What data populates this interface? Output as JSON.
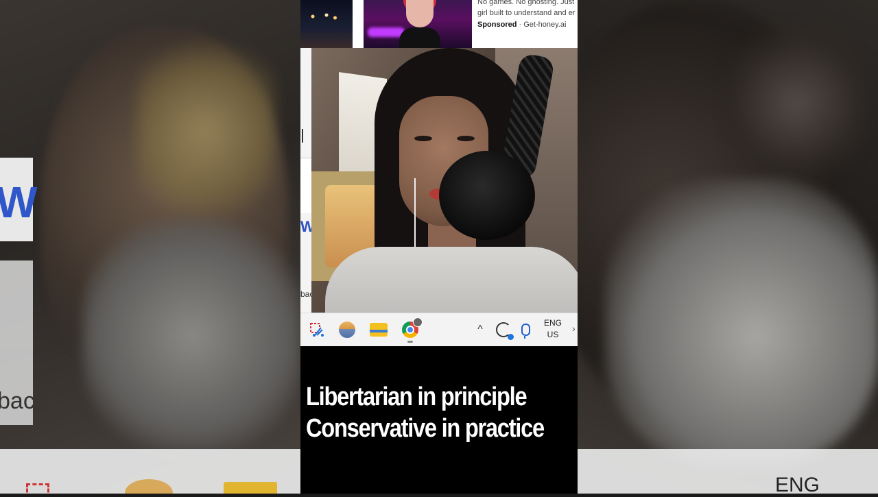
{
  "ad": {
    "line1": "No games. No ghosting. Just",
    "line2": "girl built to understand and er",
    "sponsored_label": "Sponsored",
    "separator": "·",
    "advertiser": "Get-honey.ai"
  },
  "browser": {
    "partial_letter": "W",
    "partial_text": "bac"
  },
  "background": {
    "left_letter": "W",
    "left_text": "bac",
    "right_text": "ENG"
  },
  "taskbar": {
    "icons": [
      "snipping-tool-icon",
      "photos-icon",
      "file-explorer-icon",
      "chrome-icon",
      "chevron-up-icon",
      "sync-icon",
      "microphone-icon"
    ],
    "chevron": "^",
    "lang_top": "ENG",
    "lang_bottom": "US"
  },
  "caption": {
    "line1": "Libertarian in principle",
    "line2": "Conservative in practice"
  },
  "colors": {
    "caption_text": "#ffffff",
    "taskbar_bg": "#f3f3f3",
    "folder_yellow": "#f4c01f",
    "link_blue": "#2a52c7"
  }
}
